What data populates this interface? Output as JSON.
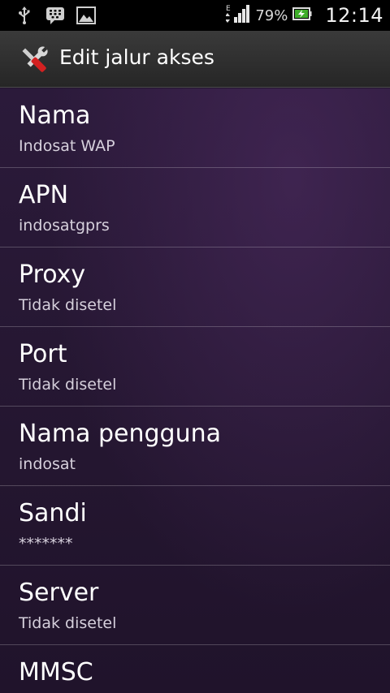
{
  "status_bar": {
    "icons": [
      "usb-icon",
      "bbm-message-icon",
      "gallery-icon"
    ],
    "network": "E",
    "battery_percent": "79%",
    "time": "12:14"
  },
  "title_bar": {
    "icon": "tools-icon",
    "title": "Edit jalur akses"
  },
  "settings": [
    {
      "title": "Nama",
      "value": "Indosat WAP"
    },
    {
      "title": "APN",
      "value": "indosatgprs"
    },
    {
      "title": "Proxy",
      "value": "Tidak disetel"
    },
    {
      "title": "Port",
      "value": "Tidak disetel"
    },
    {
      "title": "Nama pengguna",
      "value": "indosat"
    },
    {
      "title": "Sandi",
      "value": "*******"
    },
    {
      "title": "Server",
      "value": "Tidak disetel"
    },
    {
      "title": "MMSC",
      "value": ""
    }
  ]
}
